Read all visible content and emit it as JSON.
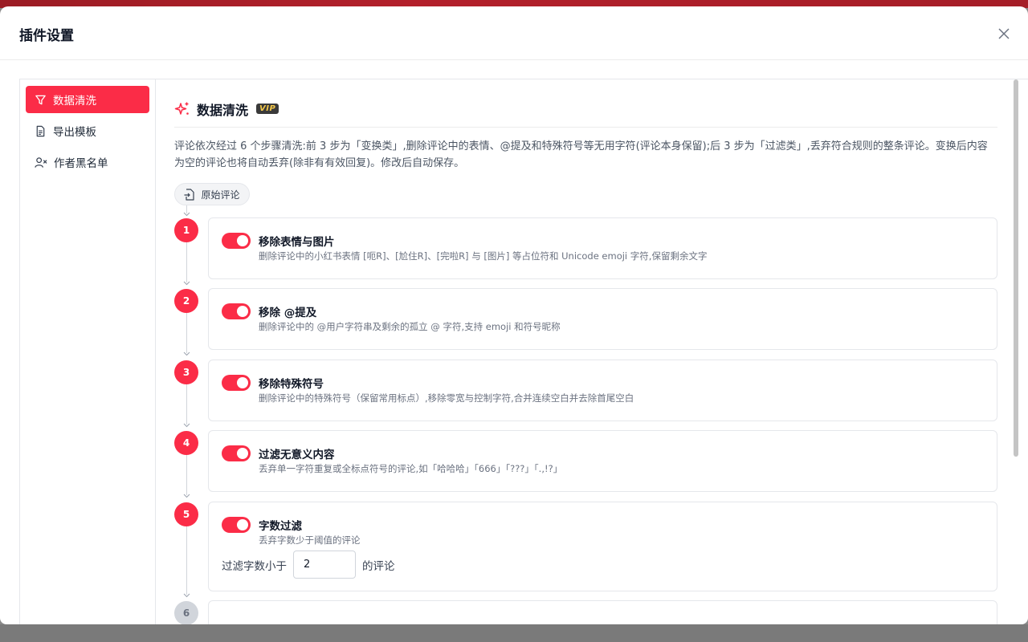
{
  "modal": {
    "title": "插件设置"
  },
  "sidebar": {
    "items": [
      {
        "label": "数据清洗",
        "icon": "filter-icon",
        "active": true
      },
      {
        "label": "导出模板",
        "icon": "document-icon",
        "active": false
      },
      {
        "label": "作者黑名单",
        "icon": "user-x-icon",
        "active": false
      }
    ]
  },
  "section": {
    "title": "数据清洗",
    "badge": "VIP",
    "description": "评论依次经过 6 个步骤清洗:前 3 步为「变换类」,删除评论中的表情、@提及和特殊符号等无用字符(评论本身保留);后 3 步为「过滤类」,丢弃符合规则的整条评论。变换后内容为空的评论也将自动丢弃(除非有有效回复)。修改后自动保存。",
    "source_chip": "原始评论"
  },
  "steps": [
    {
      "num": "1",
      "title": "移除表情与图片",
      "desc": "删除评论中的小红书表情 [呃R]、[尬住R]、[完啦R] 与 [图片] 等占位符和 Unicode emoji 字符,保留剩余文字",
      "enabled": true
    },
    {
      "num": "2",
      "title": "移除 @提及",
      "desc": "删除评论中的 @用户字符串及剩余的孤立 @ 字符,支持 emoji 和符号昵称",
      "enabled": true
    },
    {
      "num": "3",
      "title": "移除特殊符号",
      "desc": "删除评论中的特殊符号（保留常用标点）,移除零宽与控制字符,合并连续空白并去除首尾空白",
      "enabled": true
    },
    {
      "num": "4",
      "title": "过滤无意义内容",
      "desc": "丢弃单一字符重复或全标点符号的评论,如「哈哈哈」「666」「???」「.,!?」",
      "enabled": true
    },
    {
      "num": "5",
      "title": "字数过滤",
      "desc": "丢弃字数少于阈值的评论",
      "enabled": true,
      "threshold": {
        "prefix": "过滤字数小于",
        "value": "2",
        "suffix": "的评论"
      }
    },
    {
      "num": "6",
      "enabled": false
    }
  ],
  "colors": {
    "accent": "#fb2c47",
    "vip_bg": "#3a3a3a",
    "vip_fg": "#f4c84a"
  }
}
